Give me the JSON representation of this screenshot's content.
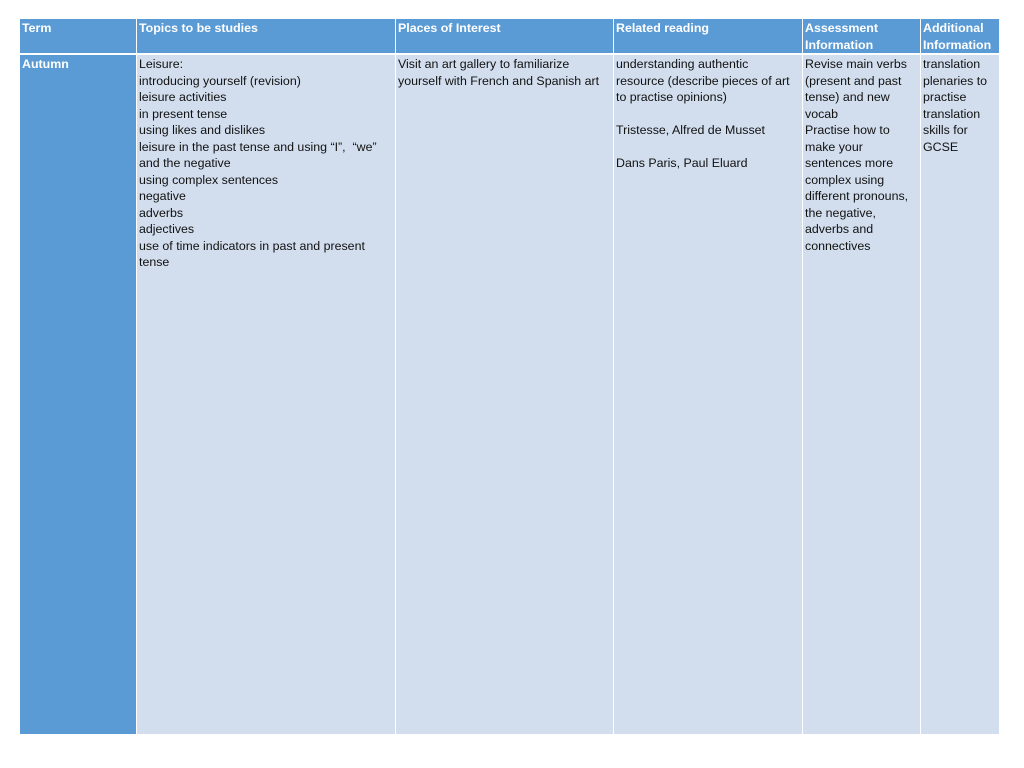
{
  "table": {
    "headers": [
      "Term",
      "Topics to be studies",
      "Places of Interest",
      "Related reading",
      "Assessment Information",
      "Additional Information"
    ],
    "colors": {
      "header_bg": "#5b9bd5",
      "header_text": "#ffffff",
      "body_bg": "#d2deee",
      "body_text": "#111111"
    },
    "rows": [
      {
        "term": "Autumn",
        "topics": [
          "Leisure:",
          "introducing yourself (revision)",
          "leisure activities",
          "in present tense",
          "using likes and dislikes",
          "leisure in the past tense and using “I”,  “we”",
          "and the negative",
          "using complex sentences",
          "negative",
          "adverbs",
          "adjectives",
          "use of time indicators in past and present",
          "tense"
        ],
        "places": [
          "Visit an art gallery to familiarize",
          "yourself with French and Spanish art"
        ],
        "reading": [
          "understanding authentic",
          "resource (describe pieces of art",
          "to practise opinions)",
          "",
          "Tristesse, Alfred de Musset",
          "",
          "Dans Paris, Paul Eluard"
        ],
        "assessment": [
          "Revise main verbs",
          "(present and past",
          "tense) and new",
          "vocab",
          "Practise how to",
          "make your",
          "sentences more",
          "complex using",
          "different pronouns,",
          "the negative,",
          "adverbs and",
          "connectives"
        ],
        "additional": [
          "translation",
          "plenaries to",
          "practise",
          "translation",
          "skills for",
          "GCSE"
        ]
      }
    ]
  }
}
